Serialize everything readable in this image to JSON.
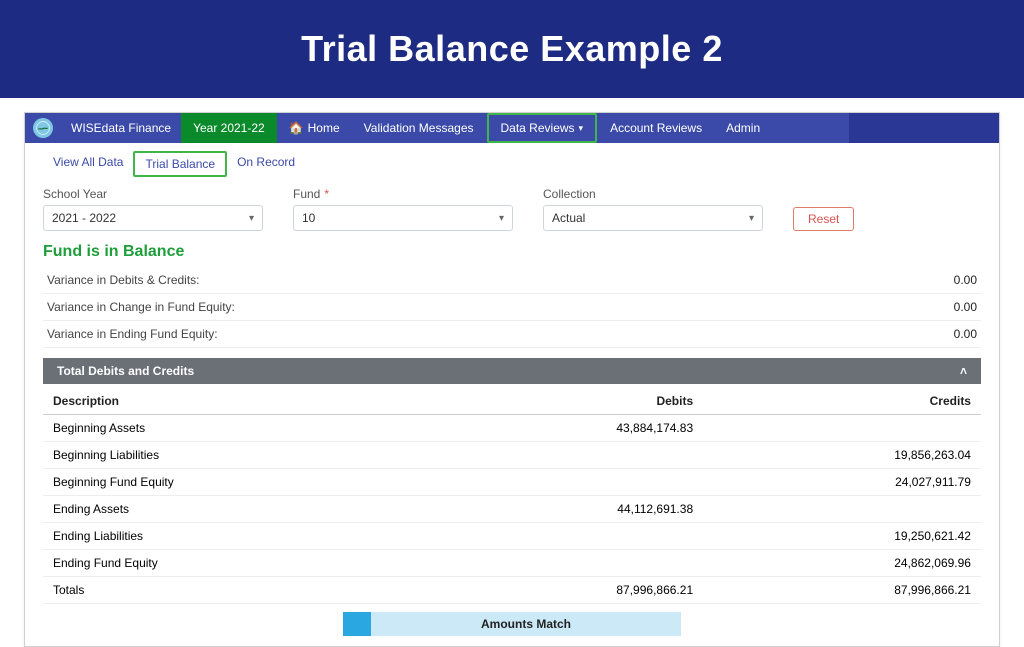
{
  "page_title": "Trial Balance Example 2",
  "topnav": {
    "brand": "WISEdata Finance",
    "year": "Year 2021-22",
    "items": {
      "home": "Home",
      "validation": "Validation Messages",
      "data_reviews": "Data Reviews",
      "account_reviews": "Account Reviews",
      "admin": "Admin"
    }
  },
  "subtabs": {
    "view_all": "View All Data",
    "trial_balance": "Trial Balance",
    "on_record": "On Record"
  },
  "filters": {
    "school_year_label": "School Year",
    "school_year_value": "2021 - 2022",
    "fund_label": "Fund",
    "fund_value": "10",
    "collection_label": "Collection",
    "collection_value": "Actual",
    "reset": "Reset"
  },
  "status_heading": "Fund is in Balance",
  "variance": {
    "rows": [
      {
        "label": "Variance in Debits & Credits:",
        "value": "0.00"
      },
      {
        "label": "Variance in Change in Fund Equity:",
        "value": "0.00"
      },
      {
        "label": "Variance in Ending Fund Equity:",
        "value": "0.00"
      }
    ]
  },
  "section_bar": "Total Debits and Credits",
  "table": {
    "headers": {
      "description": "Description",
      "debits": "Debits",
      "credits": "Credits"
    },
    "rows": [
      {
        "description": "Beginning Assets",
        "debits": "43,884,174.83",
        "credits": ""
      },
      {
        "description": "Beginning Liabilities",
        "debits": "",
        "credits": "19,856,263.04"
      },
      {
        "description": "Beginning Fund Equity",
        "debits": "",
        "credits": "24,027,911.79"
      },
      {
        "description": "Ending Assets",
        "debits": "44,112,691.38",
        "credits": ""
      },
      {
        "description": "Ending Liabilities",
        "debits": "",
        "credits": "19,250,621.42"
      },
      {
        "description": "Ending Fund Equity",
        "debits": "",
        "credits": "24,862,069.96"
      },
      {
        "description": "Totals",
        "debits": "87,996,866.21",
        "credits": "87,996,866.21"
      }
    ]
  },
  "match_bar_label": "Amounts Match"
}
